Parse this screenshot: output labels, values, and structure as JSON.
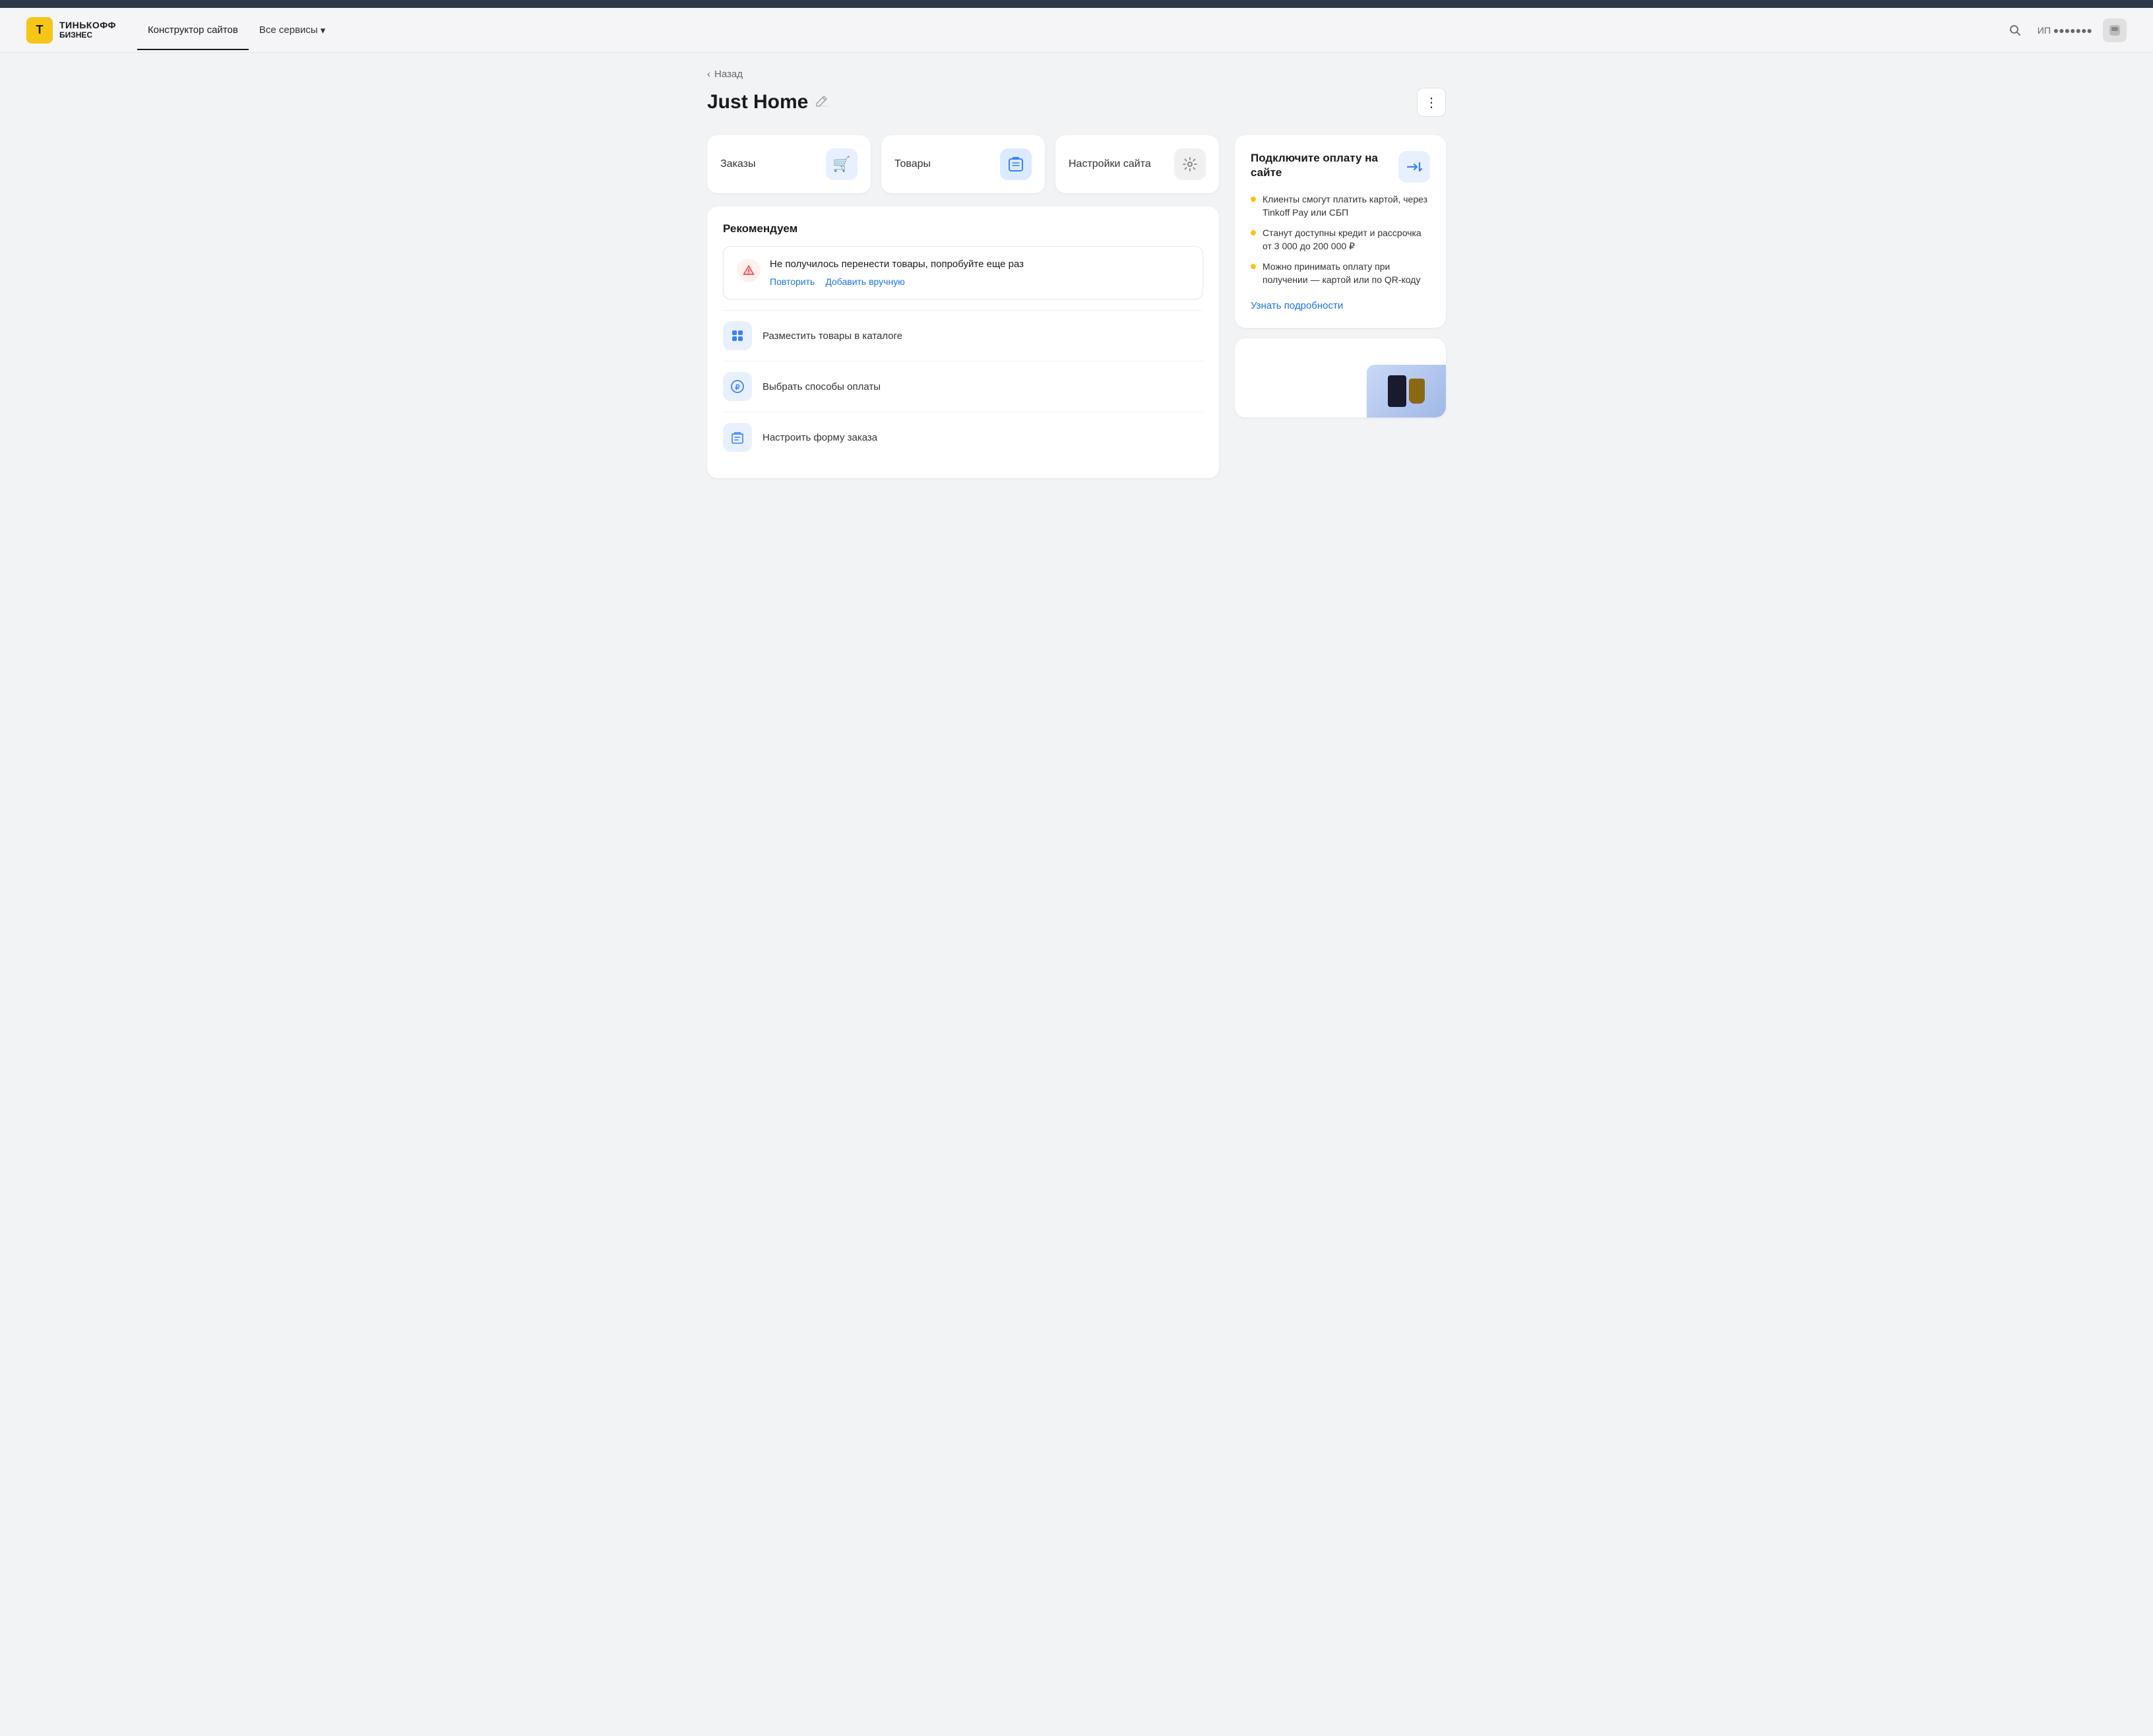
{
  "topbar": {},
  "header": {
    "logo_letter": "T",
    "logo_line1": "ТИНЬКОФФ",
    "logo_line2": "БИЗНЕС",
    "nav": [
      {
        "label": "Конструктор сайтов",
        "active": true
      },
      {
        "label": "Все сервисы",
        "has_dropdown": true
      }
    ],
    "user_label": "ИП ●●●●●●●"
  },
  "back_label": "Назад",
  "page_title": "Just Home",
  "more_button_label": "⋮",
  "quick_actions": [
    {
      "label": "Заказы",
      "icon": "🛒",
      "icon_class": "icon-blue-light"
    },
    {
      "label": "Товары",
      "icon": "📦",
      "icon_class": "icon-blue"
    },
    {
      "label": "Настройки сайта",
      "icon": "⚙️",
      "icon_class": "icon-gray"
    }
  ],
  "recommendations": {
    "title": "Рекомендуем",
    "error_notice": {
      "text": "Не получилось перенести товары, попробуйте еще раз",
      "retry_label": "Повторить",
      "manual_label": "Добавить вручную"
    },
    "items": [
      {
        "label": "Разместить товары в каталоге",
        "icon": "▦"
      },
      {
        "label": "Выбрать способы оплаты",
        "icon": "₽"
      },
      {
        "label": "Настроить форму заказа",
        "icon": "🛒"
      }
    ]
  },
  "payment_promo": {
    "title": "Подключите оплату на сайте",
    "bullets": [
      "Клиенты смогут платить картой, через Tinkoff Pay или СБП",
      "Станут доступны кредит и рассрочка от 3 000 до 200 000 ₽",
      "Можно принимать оплату при получении — картой или по QR-коду"
    ],
    "learn_more": "Узнать подробности"
  }
}
